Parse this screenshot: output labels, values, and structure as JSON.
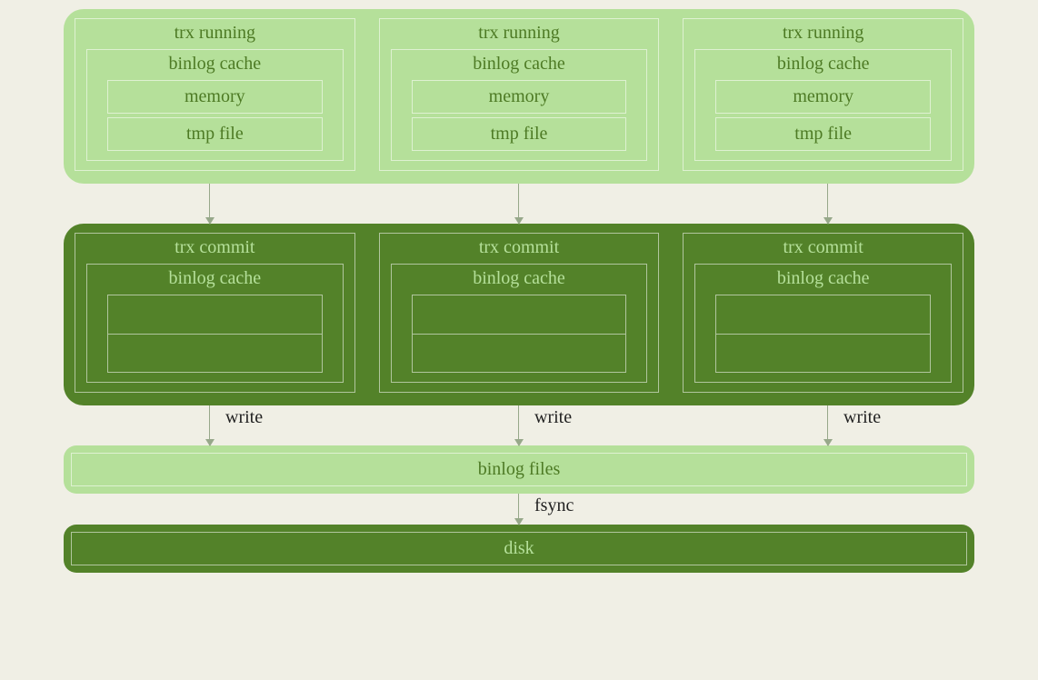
{
  "top": {
    "cols": [
      {
        "title": "trx running",
        "cache": "binlog cache",
        "a": "memory",
        "b": "tmp file"
      },
      {
        "title": "trx running",
        "cache": "binlog cache",
        "a": "memory",
        "b": "tmp file"
      },
      {
        "title": "trx running",
        "cache": "binlog cache",
        "a": "memory",
        "b": "tmp file"
      }
    ]
  },
  "mid": {
    "cols": [
      {
        "title": "trx commit",
        "cache": "binlog cache"
      },
      {
        "title": "trx commit",
        "cache": "binlog cache"
      },
      {
        "title": "trx commit",
        "cache": "binlog cache"
      }
    ]
  },
  "edges": {
    "write": "write",
    "fsync": "fsync"
  },
  "files": {
    "label": "binlog files"
  },
  "disk": {
    "label": "disk"
  }
}
